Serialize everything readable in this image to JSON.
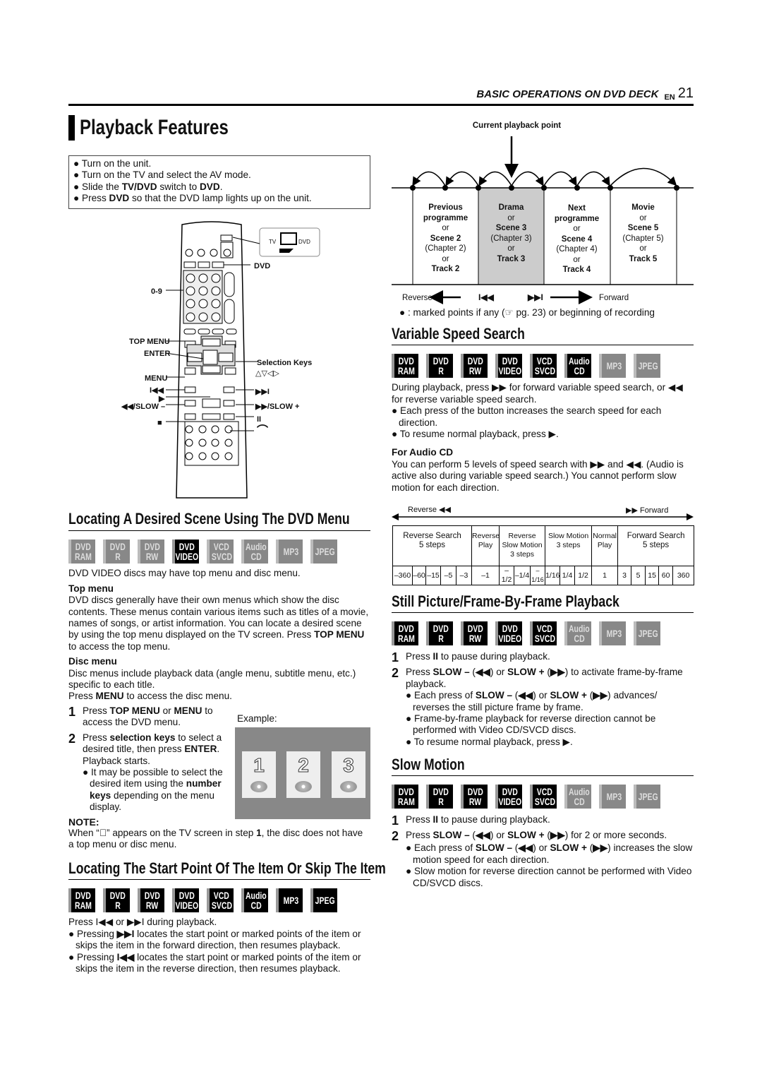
{
  "header": {
    "section": "BASIC OPERATIONS ON DVD DECK",
    "lang": "EN",
    "page": "21"
  },
  "title": "Playback Features",
  "prep": [
    [
      "Turn on the unit."
    ],
    [
      "Turn on the TV and select the AV mode."
    ],
    [
      "Slide the ",
      {
        "b": "TV/DVD"
      },
      " switch to ",
      {
        "b": "DVD"
      },
      "."
    ],
    [
      "Press ",
      {
        "b": "DVD"
      },
      " so that the DVD lamp lights up on the unit."
    ]
  ],
  "remote": {
    "switch_tv": "TV",
    "switch_dvd": "DVD",
    "labels": {
      "dvd": "DVD",
      "digits": "0-9",
      "top_menu": "TOP MENU",
      "enter": "ENTER",
      "menu": "MENU",
      "prev": "I◀◀",
      "play": "▶",
      "slow_minus": "◀◀/SLOW –",
      "stop": "■",
      "selection_keys": "Selection Keys",
      "selection_arrows": "△▽◁▷",
      "next": "▶▶I",
      "slow_plus": "▶▶/SLOW +",
      "pause": "II",
      "skip": "⌒"
    }
  },
  "badge_labels": [
    [
      "DVD",
      "RAM"
    ],
    [
      "DVD",
      "R"
    ],
    [
      "DVD",
      "RW"
    ],
    [
      "DVD",
      "VIDEO"
    ],
    [
      "VCD",
      "SVCD"
    ],
    [
      "Audio",
      "CD"
    ],
    [
      "MP3"
    ],
    [
      "JPEG"
    ]
  ],
  "colors": {
    "active_badge": "#000000",
    "inactive_badge": "#888888",
    "highlight_cell": "#cccccc"
  },
  "locating_menu": {
    "heading": "Locating A Desired Scene Using The DVD Menu",
    "badges_active": [
      false,
      false,
      false,
      true,
      false,
      false,
      false,
      false
    ],
    "intro": "DVD VIDEO discs may have top menu and disc menu.",
    "top_menu_title": "Top menu",
    "top_menu_text": [
      "DVD discs generally have their own menus which show the disc contents. These menus contain various items such as titles of a movie, names of songs, or artist information. You can locate a desired scene by using the top menu displayed on the TV screen. Press ",
      {
        "b": "TOP MENU"
      },
      " to access the top menu."
    ],
    "disc_menu_title": "Disc menu",
    "disc_menu_text": "Disc menus include playback data (angle menu, subtitle menu, etc.) specific to each title.",
    "disc_menu_press": [
      "Press ",
      {
        "b": "MENU"
      },
      " to access the disc menu."
    ],
    "steps": [
      {
        "n": "1",
        "text": [
          "Press ",
          {
            "b": "TOP MENU"
          },
          " or ",
          {
            "b": "MENU"
          },
          " to access the DVD menu."
        ]
      },
      {
        "n": "2",
        "text": [
          "Press ",
          {
            "b": "selection keys"
          },
          " to select a desired title, then press ",
          {
            "b": "ENTER"
          },
          ". Playback starts."
        ]
      }
    ],
    "step2_bullet": [
      "It may be possible to select the desired item using the ",
      {
        "b": "number keys"
      },
      " depending on the menu display."
    ],
    "example_label": "Example:",
    "example_items": [
      "1",
      "2",
      "3"
    ],
    "note_title": "NOTE:",
    "note_text": [
      "When “⃠” appears on the TV screen in step ",
      {
        "b": "1"
      },
      ", the disc does not have a top menu or disc menu."
    ]
  },
  "locating_start": {
    "heading": "Locating The Start Point Of The Item Or Skip The Item",
    "badges_active": [
      true,
      true,
      true,
      true,
      true,
      true,
      true,
      true
    ],
    "intro": "Press I◀◀ or ▶▶I during playback.",
    "bullets": [
      [
        "Pressing ",
        {
          "b": "▶▶I"
        },
        " locates the start point or marked points of the item or skips the item in the forward direction, then resumes playback."
      ],
      [
        "Pressing ",
        {
          "b": "I◀◀"
        },
        " locates the start point or marked points of the item or skips the item in the reverse direction, then resumes playback."
      ]
    ]
  },
  "diagram": {
    "current_label": "Current playback point",
    "cells": [
      [
        {
          "b": "Previous"
        },
        {
          "b": "programme"
        },
        "or",
        {
          "b": "Scene 2"
        },
        "(Chapter 2)",
        "or",
        {
          "b": "Track 2"
        }
      ],
      [
        {
          "b": "Drama"
        },
        "or",
        {
          "b": "Scene 3"
        },
        "(Chapter 3)",
        "or",
        {
          "b": "Track 3"
        }
      ],
      [
        {
          "b": "Next"
        },
        {
          "b": "programme"
        },
        "or",
        {
          "b": "Scene 4"
        },
        "(Chapter 4)",
        "or",
        {
          "b": "Track 4"
        }
      ],
      [
        {
          "b": "Movie"
        },
        "or",
        {
          "b": "Scene 5"
        },
        "(Chapter 5)",
        "or",
        {
          "b": "Track 5"
        }
      ]
    ],
    "reverse": "Reverse",
    "forward": "Forward",
    "prev_sym": "I◀◀",
    "next_sym": "▶▶I",
    "legend": "● : marked points if any (☞ pg. 23) or beginning of recording"
  },
  "variable": {
    "heading": "Variable Speed Search",
    "badges_active": [
      true,
      true,
      true,
      true,
      true,
      true,
      false,
      false
    ],
    "p1": "During playback, press ▶▶ for forward variable speed search, or ◀◀ for reverse variable speed search.",
    "bullets": [
      "Each press of the button increases the search speed for each direction.",
      "To resume normal playback, press ▶."
    ],
    "audio_title": "For Audio CD",
    "audio_text": "You can perform 5 levels of speed search with ▶▶ and ◀◀. (Audio is active also during variable speed search.) You cannot perform slow motion for each direction.",
    "reverse_label": "Reverse ◀◀",
    "forward_label": "▶▶ Forward",
    "groups": [
      [
        "Reverse Search",
        "5 steps"
      ],
      [
        "Reverse",
        "Play"
      ],
      [
        "Reverse",
        "Slow Motion",
        "3 steps"
      ],
      [
        "Slow Motion",
        "3 steps"
      ],
      [
        "Normal",
        "Play"
      ],
      [
        "Forward Search",
        "5 steps"
      ]
    ],
    "speeds": [
      "–360",
      "–60",
      "–15",
      "–5",
      "–3",
      "–1",
      "–1/2",
      "–1/4",
      "–1/16",
      "1/16",
      "1/4",
      "1/2",
      "1",
      "3",
      "5",
      "15",
      "60",
      "360"
    ]
  },
  "still": {
    "heading": "Still Picture/Frame-By-Frame Playback",
    "badges_active": [
      true,
      true,
      true,
      true,
      true,
      false,
      false,
      false
    ],
    "steps": [
      {
        "n": "1",
        "text": [
          "Press ",
          {
            "b": "II"
          },
          " to pause during playback."
        ]
      },
      {
        "n": "2",
        "text": [
          "Press ",
          {
            "b": "SLOW –"
          },
          " (",
          {
            "b": "◀◀"
          },
          ") or ",
          {
            "b": "SLOW +"
          },
          " (",
          {
            "b": "▶▶"
          },
          ") to activate frame-by-frame playback."
        ]
      }
    ],
    "bullets": [
      [
        "Each press of ",
        {
          "b": "SLOW –"
        },
        " (",
        {
          "b": "◀◀"
        },
        ") or ",
        {
          "b": "SLOW +"
        },
        " (",
        {
          "b": "▶▶"
        },
        ") advances/ reverses the still picture frame by frame."
      ],
      [
        "Frame-by-frame playback for reverse direction cannot be performed with Video CD/SVCD discs."
      ],
      [
        "To resume normal playback, press ▶."
      ]
    ]
  },
  "slow": {
    "heading": "Slow Motion",
    "badges_active": [
      true,
      true,
      true,
      true,
      true,
      false,
      false,
      false
    ],
    "steps": [
      {
        "n": "1",
        "text": [
          "Press ",
          {
            "b": "II"
          },
          " to pause during playback."
        ]
      },
      {
        "n": "2",
        "text": [
          "Press ",
          {
            "b": "SLOW –"
          },
          " (",
          {
            "b": "◀◀"
          },
          ") or ",
          {
            "b": "SLOW +"
          },
          " (",
          {
            "b": "▶▶"
          },
          ") for 2 or more seconds."
        ]
      }
    ],
    "bullets": [
      [
        "Each press of ",
        {
          "b": "SLOW –"
        },
        " (",
        {
          "b": "◀◀"
        },
        ") or ",
        {
          "b": "SLOW +"
        },
        " (",
        {
          "b": "▶▶"
        },
        ") increases the slow motion speed for each direction."
      ],
      [
        "Slow motion for reverse direction cannot be performed with Video CD/SVCD discs."
      ]
    ]
  }
}
